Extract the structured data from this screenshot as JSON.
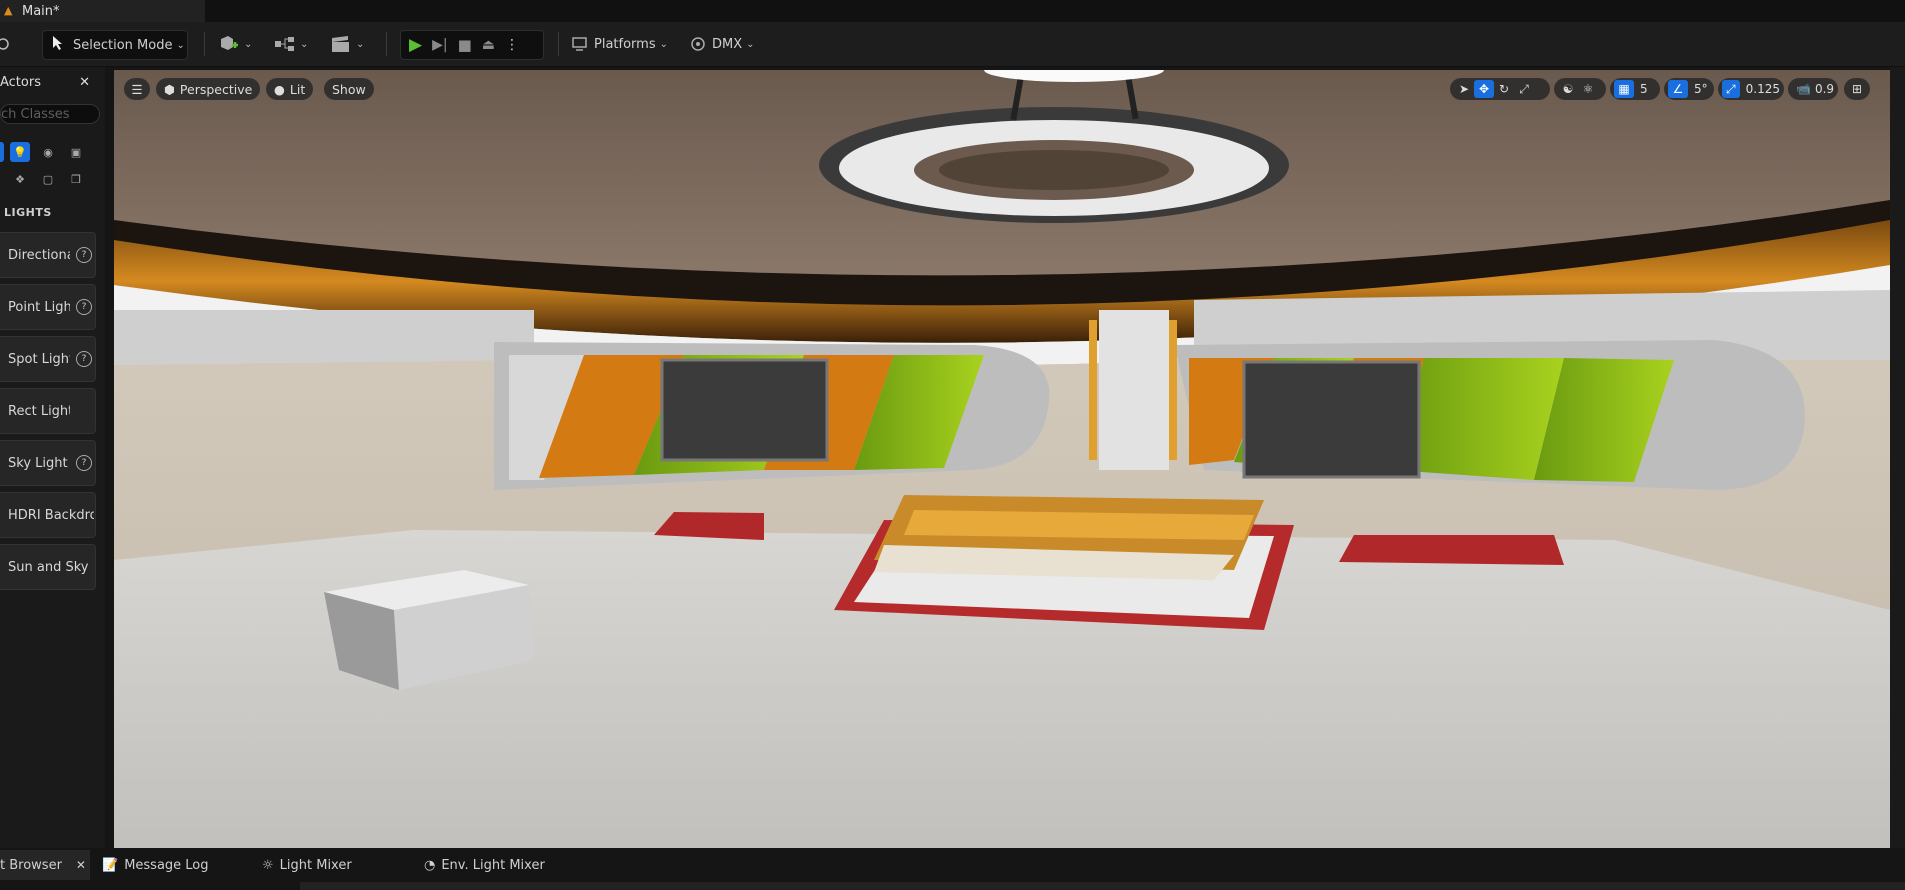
{
  "window": {
    "main_tab_title": "Main*"
  },
  "toolbar": {
    "selection_mode": "Selection Mode",
    "platforms": "Platforms",
    "dmx": "DMX"
  },
  "left_panel": {
    "title": "Actors",
    "search_placeholder": "ch Classes",
    "section_title": "LIGHTS",
    "items": [
      {
        "label": "Directiona",
        "help": "?"
      },
      {
        "label": "Point Light",
        "help": "?"
      },
      {
        "label": "Spot Light",
        "help": "?"
      },
      {
        "label": "Rect Light"
      },
      {
        "label": "Sky Light",
        "help": "?"
      },
      {
        "label": "HDRI Backdrop"
      },
      {
        "label": "Sun and Sky"
      }
    ]
  },
  "viewport": {
    "view_mode": "Perspective",
    "lighting_mode": "Lit",
    "show_label": "Show",
    "grid_snap": "5",
    "rotation_snap": "5°",
    "scale_snap": "0.125",
    "camera_speed": "0.9"
  },
  "bottom_tabs": {
    "content_browser": "t Browser",
    "message_log": "Message Log",
    "light_mixer": "Light Mixer",
    "env_light_mixer": "Env. Light Mixer"
  },
  "colors": {
    "accent_blue": "#1a6fe0",
    "play_green": "#5bbf35",
    "logo_orange": "#e08a1e"
  }
}
